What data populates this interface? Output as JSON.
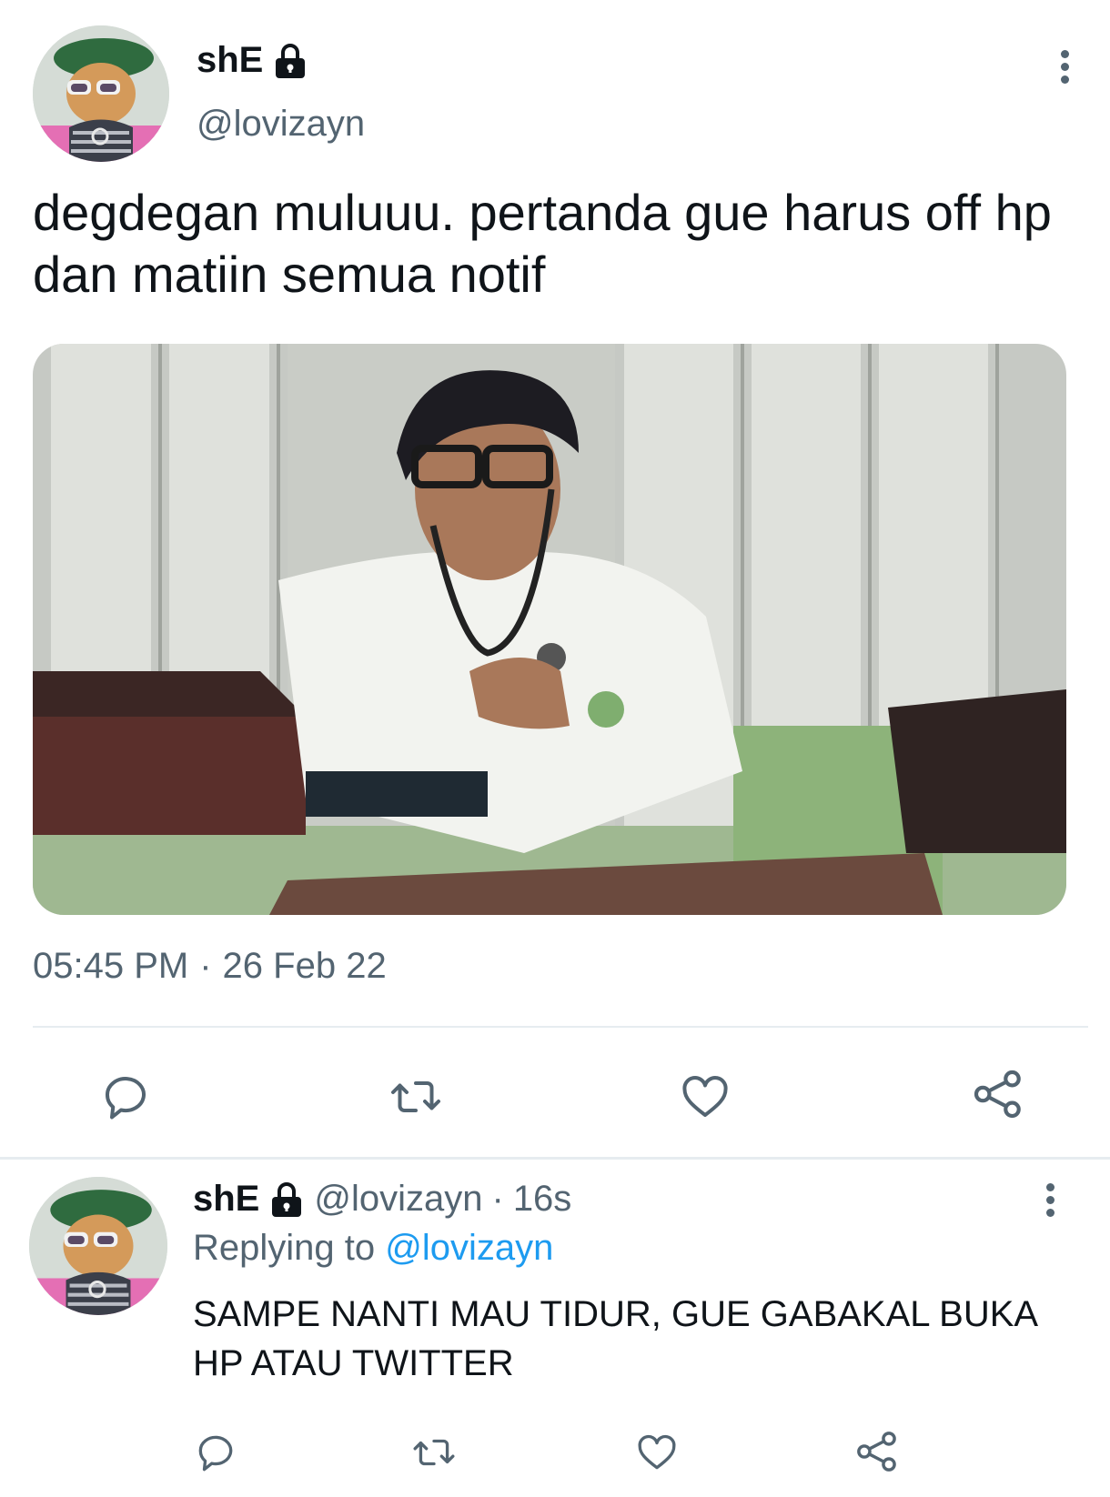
{
  "tweet": {
    "author_name": "shE",
    "handle": "@lovizayn",
    "text": "degdegan muluuu. pertanda gue harus off hp dan matiin semua notif",
    "time": "05:45 PM",
    "separator": "·",
    "date": "26 Feb 22",
    "actions": [
      "comment-icon",
      "retweet-icon",
      "like-icon",
      "share-icon"
    ]
  },
  "reply": {
    "author_name": "shE",
    "handle": "@lovizayn",
    "separator": "·",
    "age": "16s",
    "replying_label": "Replying to",
    "replying_to": "@lovizayn",
    "text": "SAMPE NANTI MAU TIDUR, GUE GABAKAL BUKA HP ATAU TWITTER",
    "actions": [
      "comment-icon",
      "retweet-icon",
      "like-icon",
      "share-icon"
    ]
  },
  "colors": {
    "text": "#0f1419",
    "secondary": "#536471",
    "link": "#1d9bf0",
    "divider": "#e6ecf0"
  }
}
